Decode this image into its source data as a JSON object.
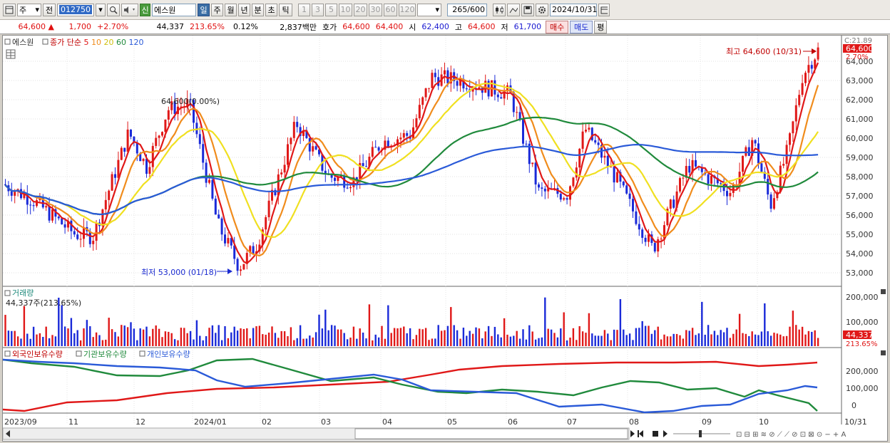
{
  "toolbar": {
    "type_btn": "주",
    "prev_btn": "전",
    "code": "012750",
    "new_badge": "신",
    "name": "에스원",
    "periods": [
      "일",
      "주",
      "월",
      "년",
      "분",
      "초",
      "틱"
    ],
    "numbers": [
      "1",
      "3",
      "5",
      "10",
      "20",
      "30",
      "60",
      "120"
    ],
    "count": "265",
    "count_total": "/600",
    "date": "2024/10/31"
  },
  "quote": {
    "price": "64,600",
    "arrow": "▲",
    "change": "1,700",
    "pct": "+2.70%",
    "volume": "44,337",
    "vol_ratio": "213.65%",
    "turnover": "0.12%",
    "amount": "2,837백만",
    "hoga_label": "호가",
    "ask": "64,600",
    "bid": "64,400",
    "open_label": "시",
    "open": "62,400",
    "high_label": "고",
    "high": "64,600",
    "low_label": "저",
    "low": "61,700",
    "buy_btn": "매수",
    "sell_btn": "매도",
    "eval_btn": "평"
  },
  "chart": {
    "legend_name": "에스원",
    "legend_ma": "종가 단순",
    "ma_periods": [
      "5",
      "10",
      "20",
      "60",
      "120"
    ],
    "ma_colors": [
      "#e01818",
      "#f08c1c",
      "#f0e020",
      "#208a3c",
      "#2a5ad8"
    ],
    "top_right": "C:21.89",
    "price_label": "64,600",
    "pct_label": "2.70%",
    "y_ticks": [
      "64,000",
      "63,000",
      "62,000",
      "61,000",
      "60,000",
      "59,000",
      "58,000",
      "57,000",
      "56,000",
      "55,000",
      "54,000",
      "53,000"
    ],
    "max_annotation": "최고 64,600 (10/31)",
    "min_annotation": "최저 53,000 (01/18)",
    "mid_annotation": "64,600(0.00%)",
    "volume_title": "거래량",
    "volume_value": "44,337주(213.65%)",
    "volume_ticks": [
      "200,000",
      "100,000"
    ],
    "volume_label": "44,337",
    "volume_pct": "213.65%",
    "holdings_labels": [
      "외국인보유수량",
      "기관보유수량",
      "개인보유수량"
    ],
    "holdings_ticks": [
      "200,000",
      "100,000",
      "0"
    ],
    "x_labels": [
      "2023/09",
      "11",
      "12",
      "2024/01",
      "02",
      "03",
      "04",
      "05",
      "06",
      "07",
      "08",
      "09",
      "10",
      "10/31"
    ],
    "bg": "#ffffff",
    "up_color": "#e01818",
    "down_color": "#1a2ad8"
  }
}
